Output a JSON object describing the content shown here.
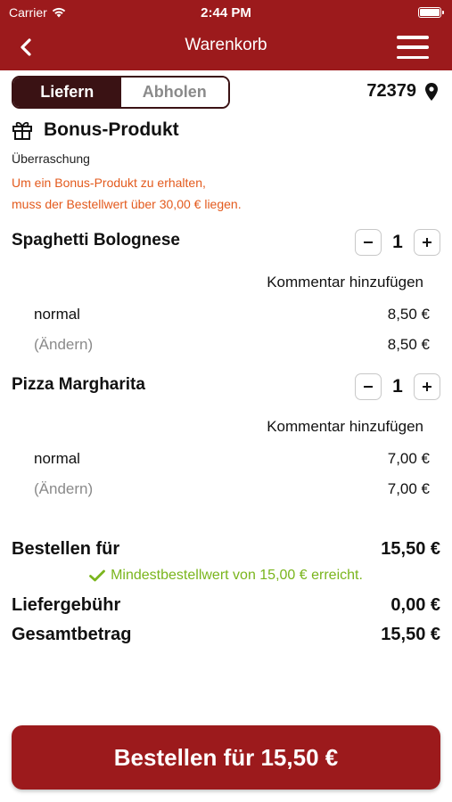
{
  "status_bar": {
    "carrier": "Carrier",
    "time": "2:44 PM"
  },
  "header": {
    "title": "Warenkorb",
    "back_icon": "chevron-left-icon",
    "menu_icon": "hamburger-menu-icon"
  },
  "delivery_toggle": {
    "options": [
      "Liefern",
      "Abholen"
    ],
    "selected": "Liefern"
  },
  "location": {
    "postal_code": "72379",
    "icon": "map-pin-icon"
  },
  "bonus": {
    "title": "Bonus-Produkt",
    "subtitle": "Überraschung",
    "note_line1": "Um ein Bonus-Produkt zu erhalten,",
    "note_line2": "muss der Bestellwert über 30,00 € liegen.",
    "note_color": "#e35a1d"
  },
  "items": [
    {
      "name": "Spaghetti Bolognese",
      "quantity": "1",
      "comment_label": "Kommentar hinzufügen",
      "variant_label": "normal",
      "variant_price": "8,50 €",
      "change_label": "(Ändern)",
      "total_price": "8,50 €"
    },
    {
      "name": "Pizza Margharita",
      "quantity": "1",
      "comment_label": "Kommentar hinzufügen",
      "variant_label": "normal",
      "variant_price": "7,00 €",
      "change_label": "(Ändern)",
      "total_price": "7,00 €"
    }
  ],
  "summary": {
    "order_label": "Bestellen für",
    "order_value": "15,50 €",
    "min_order_message": "Mindestbestellwert von 15,00 € erreicht.",
    "delivery_fee_label": "Liefergebühr",
    "delivery_fee_value": "0,00 €",
    "total_label": "Gesamtbetrag",
    "total_value": "15,50 €"
  },
  "order_button": {
    "label": "Bestellen für 15,50 €"
  },
  "colors": {
    "brand": "#9c1a1c",
    "toggle_active": "#3a1214",
    "success": "#7ab51d",
    "warning": "#e35a1d"
  }
}
